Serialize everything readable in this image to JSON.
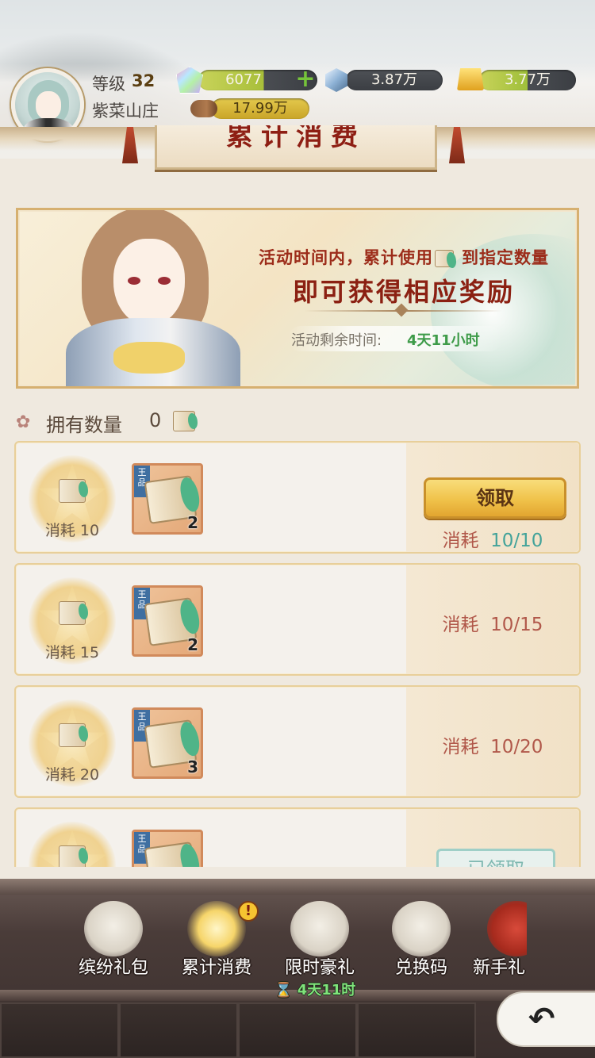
{
  "header": {
    "level_label": "等级",
    "level_value": "32",
    "estate_name": "紫菜山庄",
    "resources": {
      "gems": "6077",
      "crystal": "3.87万",
      "gold": "3.77万",
      "wood": "17.99万"
    },
    "plus_symbol": "+",
    "title_partial": "累计消费"
  },
  "banner": {
    "line1_a": "活动时间内，累计使用",
    "line1_b": "到指定数量",
    "line2": "即可获得相应奖励",
    "time_label": "活动剩余时间:",
    "time_value": "4天11小时"
  },
  "owned": {
    "label": "拥有数量",
    "count": "0"
  },
  "rows": [
    {
      "badge_label": "消耗 10",
      "item_tag": "王品",
      "item_qty": "2",
      "progress_label": "消耗",
      "progress_value": "10/10",
      "button_label": "领取"
    },
    {
      "badge_label": "消耗 15",
      "item_tag": "王品",
      "item_qty": "2",
      "progress_label": "消耗",
      "progress_value": "10/15"
    },
    {
      "badge_label": "消耗 20",
      "item_tag": "王品",
      "item_qty": "3",
      "progress_label": "消耗",
      "progress_value": "10/20"
    },
    {
      "badge_label": "",
      "item_tag": "王品",
      "item_qty": "",
      "button_label": "已领取"
    }
  ],
  "nav": {
    "items": [
      {
        "label": "缤纷礼包",
        "icon": "girl-with-gift-icon"
      },
      {
        "label": "累计消费",
        "icon": "coins-scroll-icon",
        "alert": "!"
      },
      {
        "label": "限时豪礼",
        "icon": "silver-haired-girl-icon"
      },
      {
        "label": "兑换码",
        "icon": "girl-with-tickets-icon"
      },
      {
        "label": "新手礼",
        "icon": "treasure-chest-icon"
      }
    ],
    "timer_icon": "⌛",
    "timer": "4天11时",
    "back_icon": "↶"
  },
  "colors": {
    "accent_red": "#8b2012",
    "timer_green": "#3e9b49",
    "done_teal": "#43a39a",
    "progress_red": "#b1584a",
    "button_gold": "#f0c24a"
  }
}
